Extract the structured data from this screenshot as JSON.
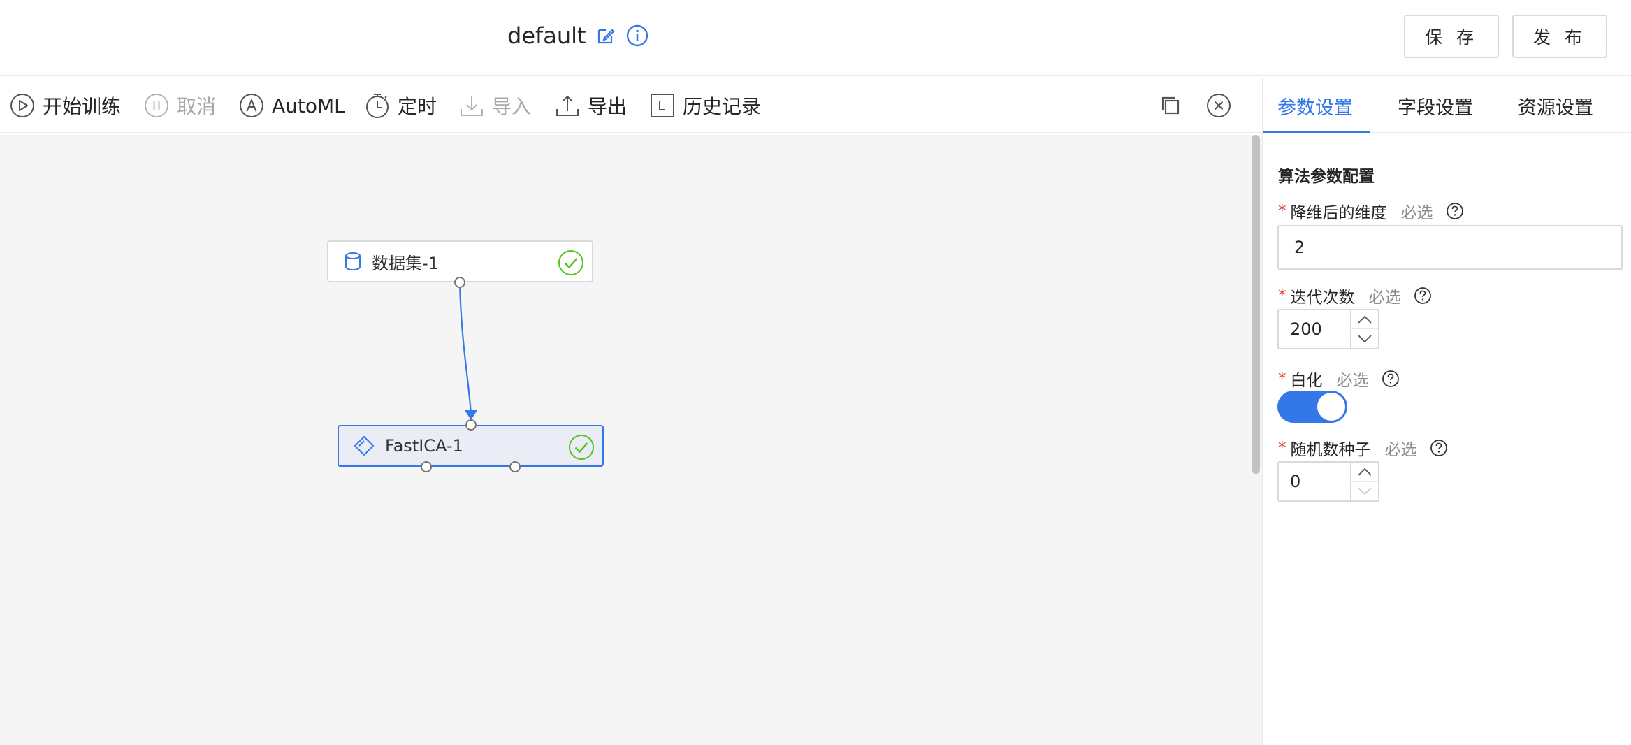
{
  "header": {
    "title": "default",
    "save_label": "保 存",
    "publish_label": "发 布"
  },
  "toolbar": {
    "items": [
      {
        "label": "开始训练",
        "icon": "play-circle-icon",
        "disabled": false
      },
      {
        "label": "取消",
        "icon": "pause-circle-icon",
        "disabled": true
      },
      {
        "label": "AutoML",
        "icon": "automl-icon",
        "disabled": false
      },
      {
        "label": "定时",
        "icon": "timer-icon",
        "disabled": false
      },
      {
        "label": "导入",
        "icon": "import-icon",
        "disabled": true
      },
      {
        "label": "导出",
        "icon": "export-icon",
        "disabled": false
      },
      {
        "label": "历史记录",
        "icon": "history-icon",
        "disabled": false
      }
    ],
    "copy_icon": "copy-icon",
    "close_icon": "close-circle-icon"
  },
  "canvas": {
    "nodes": [
      {
        "label": "数据集-1",
        "icon": "database-icon",
        "status": "success"
      },
      {
        "label": "FastICA-1",
        "icon": "algorithm-icon",
        "status": "success",
        "selected": true
      }
    ]
  },
  "panel": {
    "tabs": [
      {
        "label": "参数设置",
        "active": true
      },
      {
        "label": "字段设置",
        "active": false
      },
      {
        "label": "资源设置",
        "active": false
      }
    ],
    "section_title": "算法参数配置",
    "required_mark": "*",
    "fields": {
      "dimension": {
        "label": "降维后的维度",
        "hint": "必选",
        "value": "2"
      },
      "iterations": {
        "label": "迭代次数",
        "hint": "必选",
        "value": "200"
      },
      "whiten": {
        "label": "白化",
        "hint": "必选",
        "value": true
      },
      "seed": {
        "label": "随机数种子",
        "hint": "必选",
        "value": "0"
      }
    }
  },
  "colors": {
    "accent": "#3478e8",
    "success": "#52c41a",
    "required": "#e53935",
    "canvas_bg": "#f5f5f5"
  }
}
